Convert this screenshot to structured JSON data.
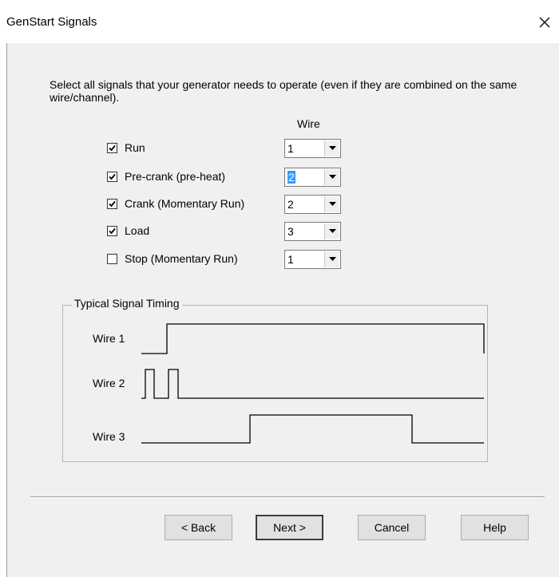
{
  "window": {
    "title": "GenStart Signals",
    "close_icon": "close-icon"
  },
  "intro_text": "Select all signals that your generator needs to operate (even if they are combined on the same wire/channel).",
  "wire_header": "Wire",
  "signals": [
    {
      "label": "Run",
      "checked": true,
      "wire": "1",
      "selected": false
    },
    {
      "label": "Pre-crank (pre-heat)",
      "checked": true,
      "wire": "2",
      "selected": true
    },
    {
      "label": "Crank (Momentary Run)",
      "checked": true,
      "wire": "2",
      "selected": false
    },
    {
      "label": "Load",
      "checked": true,
      "wire": "3",
      "selected": false
    },
    {
      "label": "Stop (Momentary Run)",
      "checked": false,
      "wire": "1",
      "selected": false
    }
  ],
  "timing": {
    "title": "Typical Signal Timing",
    "wires": [
      "Wire 1",
      "Wire 2",
      "Wire 3"
    ]
  },
  "buttons": {
    "back": "< Back",
    "next": "Next >",
    "cancel": "Cancel",
    "help": "Help"
  }
}
